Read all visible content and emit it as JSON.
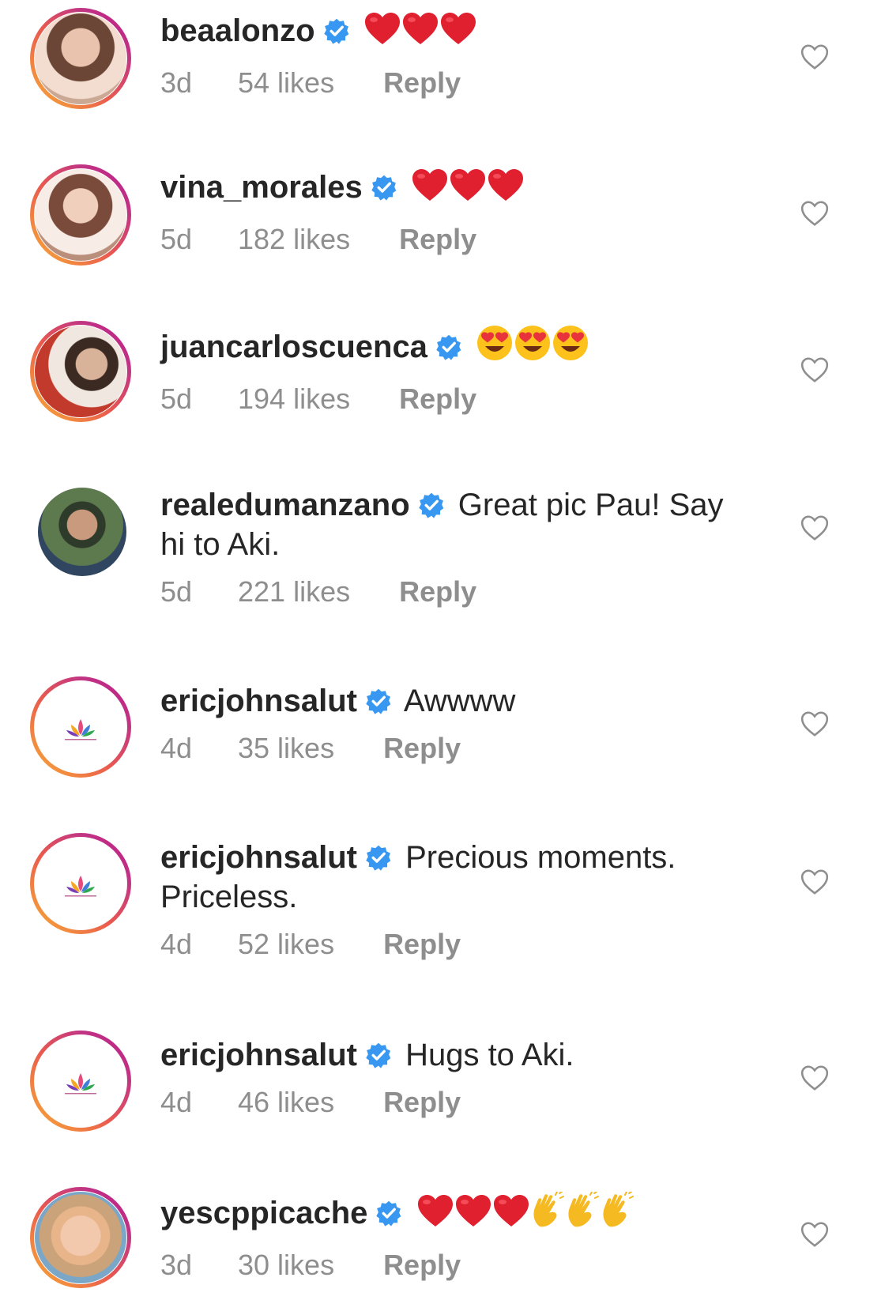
{
  "comments": [
    {
      "username": "beaalonzo",
      "text": "",
      "emoji": "hearts3",
      "time": "3d",
      "likes": "54 likes",
      "reply": "Reply"
    },
    {
      "username": "vina_morales",
      "text": "",
      "emoji": "hearts3",
      "time": "5d",
      "likes": "182 likes",
      "reply": "Reply"
    },
    {
      "username": "juancarloscuenca",
      "text": "",
      "emoji": "hearteyes3",
      "time": "5d",
      "likes": "194 likes",
      "reply": "Reply"
    },
    {
      "username": "realedumanzano",
      "text": "Great pic Pau! Say",
      "text2": "hi to Aki.",
      "time": "5d",
      "likes": "221 likes",
      "reply": "Reply"
    },
    {
      "username": "ericjohnsalut",
      "text": "Awwww",
      "time": "4d",
      "likes": "35 likes",
      "reply": "Reply"
    },
    {
      "username": "ericjohnsalut",
      "text": "Precious moments.",
      "text2": "Priceless.",
      "time": "4d",
      "likes": "52 likes",
      "reply": "Reply"
    },
    {
      "username": "ericjohnsalut",
      "text": "Hugs to Aki.",
      "time": "4d",
      "likes": "46 likes",
      "reply": "Reply"
    },
    {
      "username": "yescppicache",
      "text": "",
      "emoji": "hearts3-clap3",
      "time": "3d",
      "likes": "30 likes",
      "reply": "Reply"
    }
  ],
  "icons": {
    "verified": "verified-badge-icon",
    "like": "heart-outline-icon",
    "heart_emoji": "red-heart-emoji",
    "hearteyes_emoji": "heart-eyes-emoji",
    "clap_emoji": "clapping-hands-emoji"
  },
  "colors": {
    "verified_blue": "#3897f0",
    "meta_gray": "#8e8e8e",
    "heart_red": "#e0202f"
  }
}
